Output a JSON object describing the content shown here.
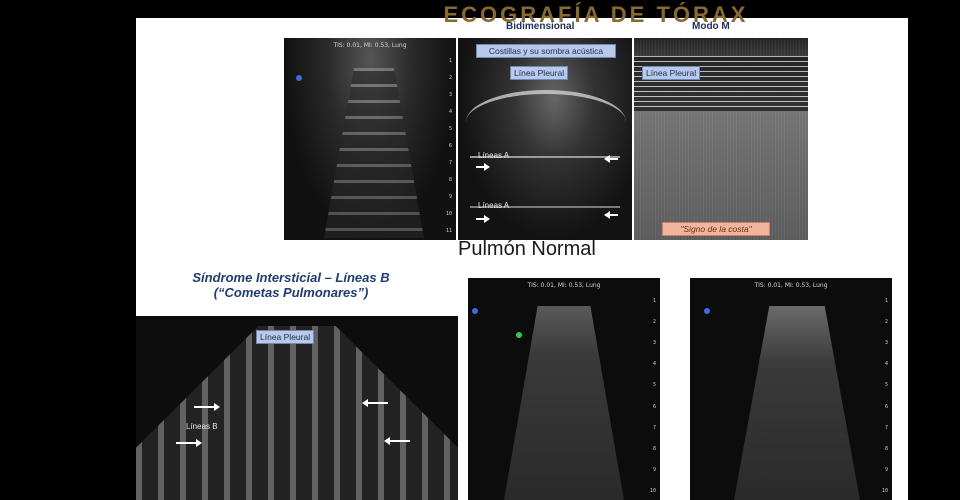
{
  "slide": {
    "top_title": "ECOGRAFÍA DE TÓRAX",
    "bidimensional_header": "Bidimensional",
    "modo_m_header": "Modo M",
    "costillas_label": "Costillas y su sombra acústica",
    "linea_pleural_label": "Línea Pleural",
    "lineas_a_label_1": "Líneas A",
    "lineas_a_label_2": "Líneas A",
    "signo_costa_label": "\"Signo de la costa\"",
    "caption_pulmon_normal": "Pulmón Normal",
    "sindrome_title_line1": "Síndrome Intersticial – Líneas B",
    "sindrome_title_line2": "(“Cometas Pulmonares”)",
    "lineas_b_label": "Líneas B",
    "scan_header": "TIS: 0.01, MI: 0.53, Lung",
    "scale_ticks": [
      "1",
      "2",
      "3",
      "4",
      "5",
      "6",
      "7",
      "8",
      "9",
      "10",
      "11"
    ]
  },
  "colors": {
    "accent": "#1f3b7a",
    "label_bg": "#b9c9e8",
    "signo_bg": "#f2b49a",
    "dot_blue": "#3a6fe0",
    "dot_green": "#29d14a"
  }
}
